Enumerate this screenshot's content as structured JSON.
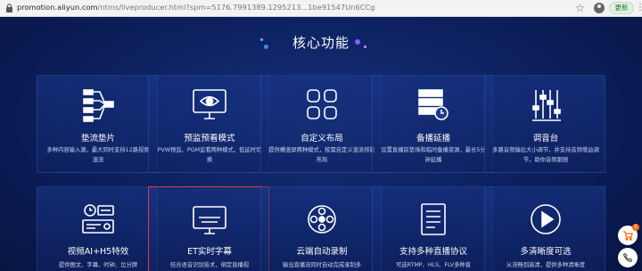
{
  "browser": {
    "url_host": "promotion.aliyun.com",
    "url_path": "/ntms/liveproducer.html?spm=5176.7991389.1295213...1be91547Un6CCg",
    "update_label": "更新"
  },
  "section": {
    "title": "核心功能"
  },
  "colors": {
    "background": "#0c1f5c",
    "accent": "#2f8cff",
    "highlight": "#e23a3a"
  },
  "cards": [
    {
      "title": "垫流垫片",
      "desc": "多种内容输入源，最大同时支持12路视频混流",
      "icon": "network-flow-icon"
    },
    {
      "title": "预监预看模式",
      "desc": "PVW预监、PGM监看两种模式，低延时切换",
      "icon": "monitor-eye-icon"
    },
    {
      "title": "自定义布局",
      "desc": "提供横竖屏两种模式，按需自定义混流排版布局",
      "icon": "grid-layout-icon"
    },
    {
      "title": "备播延播",
      "desc": "设置直播前垫场和临时备播资源，最长5分钟延播",
      "icon": "server-clock-icon"
    },
    {
      "title": "调音台",
      "desc": "多路音频输出大小调节，并支持音频增益调节，助你音频跟随",
      "icon": "mixer-sliders-icon"
    },
    {
      "title": "视频AI+H5特效",
      "desc": "提供图文、字幕、时钟、比分牌",
      "icon": "ai-effects-icon"
    },
    {
      "title": "ET实时字幕",
      "desc": "结合语音识别技术，绑定直播视",
      "icon": "subtitle-screen-icon"
    },
    {
      "title": "云端自动录制",
      "desc": "输出直播流同时自动完成录制多",
      "icon": "film-reel-icon"
    },
    {
      "title": "支持多种直播协议",
      "desc": "可选RTMP、HLS、FLV多种直",
      "icon": "document-protocol-icon"
    },
    {
      "title": "多清晰度可选",
      "desc": "从流畅到高清，提供多种清晰度",
      "icon": "play-circle-icon"
    }
  ],
  "side_buttons": [
    {
      "icon": "cart-icon",
      "badge": "5"
    },
    {
      "icon": "phone-icon"
    }
  ]
}
